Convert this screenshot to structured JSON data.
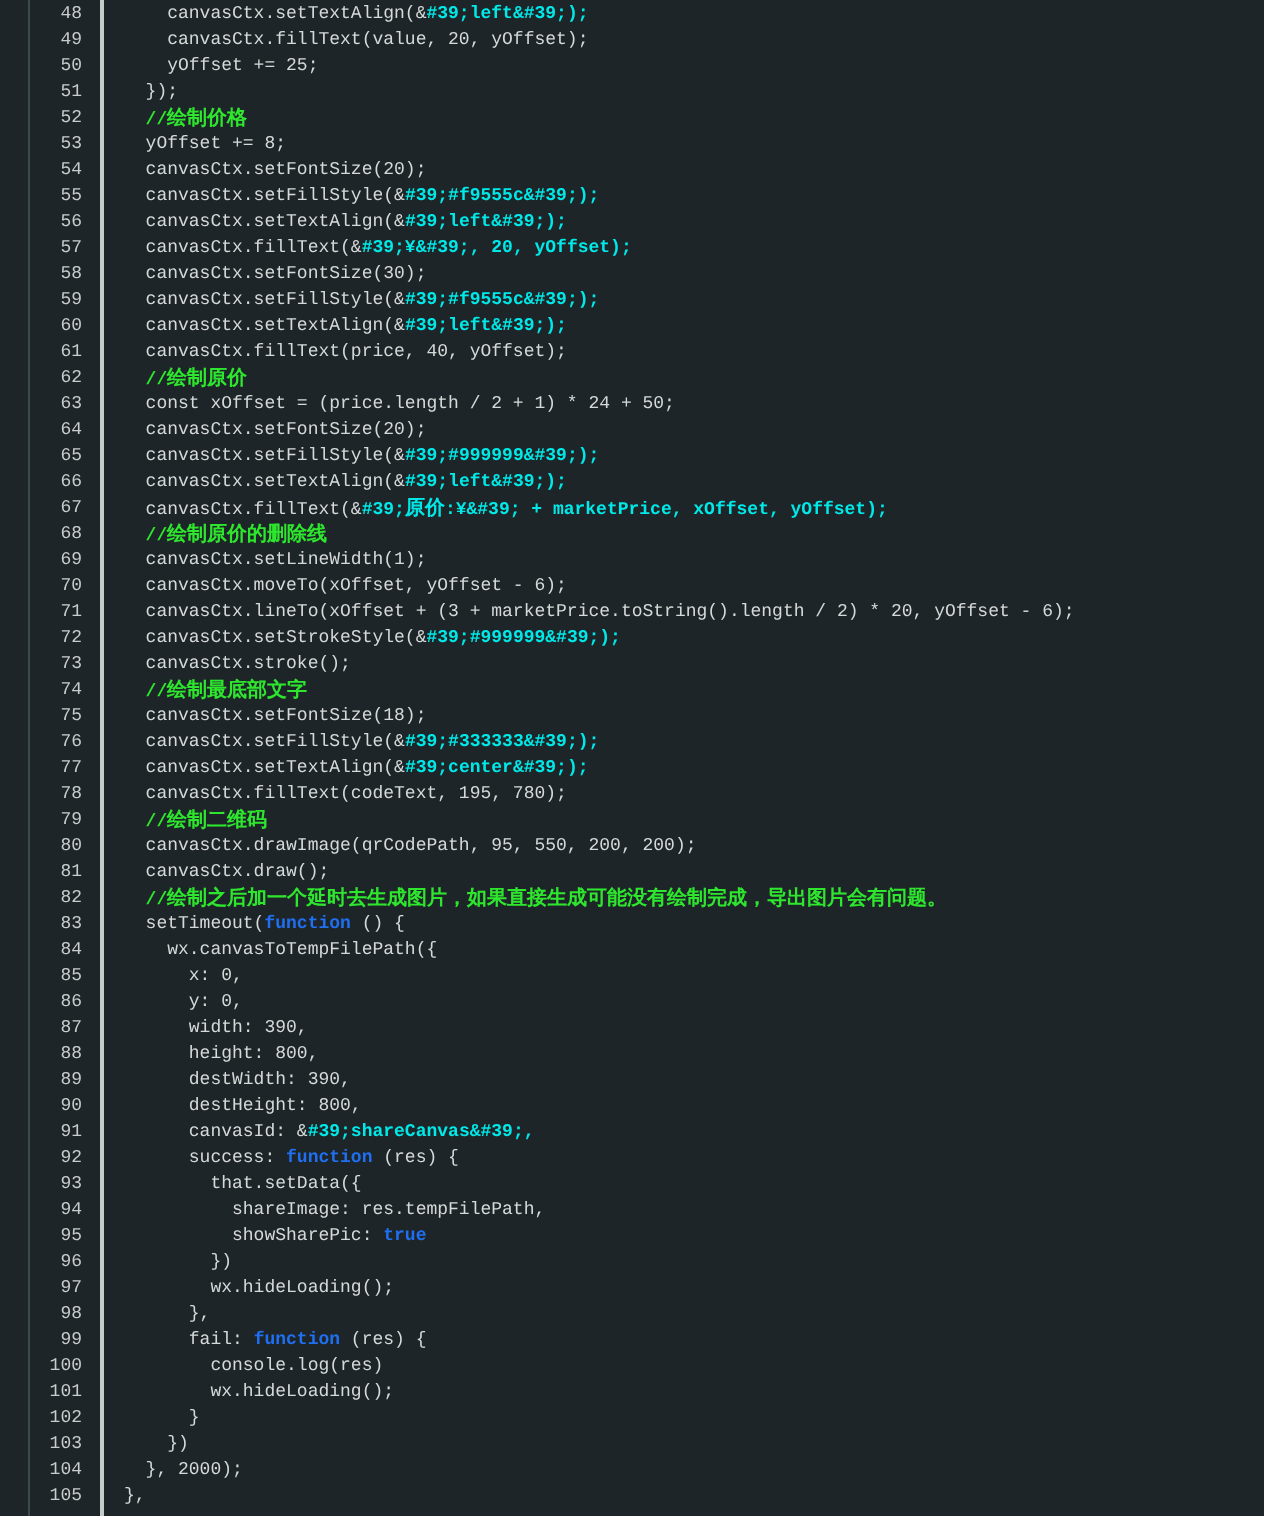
{
  "editor": {
    "lines": [
      {
        "number": "48",
        "segments": [
          {
            "kind": "plain",
            "text": "    canvasCtx.setTextAlign(&"
          },
          {
            "kind": "string",
            "text": "#39;left&#39;);"
          }
        ]
      },
      {
        "number": "49",
        "segments": [
          {
            "kind": "plain",
            "text": "    canvasCtx.fillText(value, 20, yOffset);"
          }
        ]
      },
      {
        "number": "50",
        "segments": [
          {
            "kind": "plain",
            "text": "    yOffset += 25;"
          }
        ]
      },
      {
        "number": "51",
        "segments": [
          {
            "kind": "plain",
            "text": "  });"
          }
        ]
      },
      {
        "number": "52",
        "segments": [
          {
            "kind": "comment",
            "text": "  //绘制价格"
          }
        ]
      },
      {
        "number": "53",
        "segments": [
          {
            "kind": "plain",
            "text": "  yOffset += 8;"
          }
        ]
      },
      {
        "number": "54",
        "segments": [
          {
            "kind": "plain",
            "text": "  canvasCtx.setFontSize(20);"
          }
        ]
      },
      {
        "number": "55",
        "segments": [
          {
            "kind": "plain",
            "text": "  canvasCtx.setFillStyle(&"
          },
          {
            "kind": "string",
            "text": "#39;#f9555c&#39;);"
          }
        ]
      },
      {
        "number": "56",
        "segments": [
          {
            "kind": "plain",
            "text": "  canvasCtx.setTextAlign(&"
          },
          {
            "kind": "string",
            "text": "#39;left&#39;);"
          }
        ]
      },
      {
        "number": "57",
        "segments": [
          {
            "kind": "plain",
            "text": "  canvasCtx.fillText(&"
          },
          {
            "kind": "string",
            "text": "#39;¥&#39;, 20, yOffset);"
          }
        ]
      },
      {
        "number": "58",
        "segments": [
          {
            "kind": "plain",
            "text": "  canvasCtx.setFontSize(30);"
          }
        ]
      },
      {
        "number": "59",
        "segments": [
          {
            "kind": "plain",
            "text": "  canvasCtx.setFillStyle(&"
          },
          {
            "kind": "string",
            "text": "#39;#f9555c&#39;);"
          }
        ]
      },
      {
        "number": "60",
        "segments": [
          {
            "kind": "plain",
            "text": "  canvasCtx.setTextAlign(&"
          },
          {
            "kind": "string",
            "text": "#39;left&#39;);"
          }
        ]
      },
      {
        "number": "61",
        "segments": [
          {
            "kind": "plain",
            "text": "  canvasCtx.fillText(price, 40, yOffset);"
          }
        ]
      },
      {
        "number": "62",
        "segments": [
          {
            "kind": "comment",
            "text": "  //绘制原价"
          }
        ]
      },
      {
        "number": "63",
        "segments": [
          {
            "kind": "plain",
            "text": "  const xOffset = (price.length / 2 + 1) * 24 + 50;"
          }
        ]
      },
      {
        "number": "64",
        "segments": [
          {
            "kind": "plain",
            "text": "  canvasCtx.setFontSize(20);"
          }
        ]
      },
      {
        "number": "65",
        "segments": [
          {
            "kind": "plain",
            "text": "  canvasCtx.setFillStyle(&"
          },
          {
            "kind": "string",
            "text": "#39;#999999&#39;);"
          }
        ]
      },
      {
        "number": "66",
        "segments": [
          {
            "kind": "plain",
            "text": "  canvasCtx.setTextAlign(&"
          },
          {
            "kind": "string",
            "text": "#39;left&#39;);"
          }
        ]
      },
      {
        "number": "67",
        "segments": [
          {
            "kind": "plain",
            "text": "  canvasCtx.fillText(&"
          },
          {
            "kind": "string",
            "text": "#39;原价:¥&#39; + marketPrice, xOffset, yOffset);"
          }
        ]
      },
      {
        "number": "68",
        "segments": [
          {
            "kind": "comment",
            "text": "  //绘制原价的删除线"
          }
        ]
      },
      {
        "number": "69",
        "segments": [
          {
            "kind": "plain",
            "text": "  canvasCtx.setLineWidth(1);"
          }
        ]
      },
      {
        "number": "70",
        "segments": [
          {
            "kind": "plain",
            "text": "  canvasCtx.moveTo(xOffset, yOffset - 6);"
          }
        ]
      },
      {
        "number": "71",
        "segments": [
          {
            "kind": "plain",
            "text": "  canvasCtx.lineTo(xOffset + (3 + marketPrice.toString().length / 2) * 20, yOffset - 6);"
          }
        ]
      },
      {
        "number": "72",
        "segments": [
          {
            "kind": "plain",
            "text": "  canvasCtx.setStrokeStyle(&"
          },
          {
            "kind": "string",
            "text": "#39;#999999&#39;);"
          }
        ]
      },
      {
        "number": "73",
        "segments": [
          {
            "kind": "plain",
            "text": "  canvasCtx.stroke();"
          }
        ]
      },
      {
        "number": "74",
        "segments": [
          {
            "kind": "comment",
            "text": "  //绘制最底部文字"
          }
        ]
      },
      {
        "number": "75",
        "segments": [
          {
            "kind": "plain",
            "text": "  canvasCtx.setFontSize(18);"
          }
        ]
      },
      {
        "number": "76",
        "segments": [
          {
            "kind": "plain",
            "text": "  canvasCtx.setFillStyle(&"
          },
          {
            "kind": "string",
            "text": "#39;#333333&#39;);"
          }
        ]
      },
      {
        "number": "77",
        "segments": [
          {
            "kind": "plain",
            "text": "  canvasCtx.setTextAlign(&"
          },
          {
            "kind": "string",
            "text": "#39;center&#39;);"
          }
        ]
      },
      {
        "number": "78",
        "segments": [
          {
            "kind": "plain",
            "text": "  canvasCtx.fillText(codeText, 195, 780);"
          }
        ]
      },
      {
        "number": "79",
        "segments": [
          {
            "kind": "comment",
            "text": "  //绘制二维码"
          }
        ]
      },
      {
        "number": "80",
        "segments": [
          {
            "kind": "plain",
            "text": "  canvasCtx.drawImage(qrCodePath, 95, 550, 200, 200);"
          }
        ]
      },
      {
        "number": "81",
        "segments": [
          {
            "kind": "plain",
            "text": "  canvasCtx.draw();"
          }
        ]
      },
      {
        "number": "82",
        "segments": [
          {
            "kind": "comment",
            "text": "  //绘制之后加一个延时去生成图片，如果直接生成可能没有绘制完成，导出图片会有问题。"
          }
        ]
      },
      {
        "number": "83",
        "segments": [
          {
            "kind": "plain",
            "text": "  setTimeout("
          },
          {
            "kind": "keyword",
            "text": "function"
          },
          {
            "kind": "plain",
            "text": " () {"
          }
        ]
      },
      {
        "number": "84",
        "segments": [
          {
            "kind": "plain",
            "text": "    wx.canvasToTempFilePath({"
          }
        ]
      },
      {
        "number": "85",
        "segments": [
          {
            "kind": "plain",
            "text": "      x: 0,"
          }
        ]
      },
      {
        "number": "86",
        "segments": [
          {
            "kind": "plain",
            "text": "      y: 0,"
          }
        ]
      },
      {
        "number": "87",
        "segments": [
          {
            "kind": "plain",
            "text": "      width: 390,"
          }
        ]
      },
      {
        "number": "88",
        "segments": [
          {
            "kind": "plain",
            "text": "      height: 800,"
          }
        ]
      },
      {
        "number": "89",
        "segments": [
          {
            "kind": "plain",
            "text": "      destWidth: 390,"
          }
        ]
      },
      {
        "number": "90",
        "segments": [
          {
            "kind": "plain",
            "text": "      destHeight: 800,"
          }
        ]
      },
      {
        "number": "91",
        "segments": [
          {
            "kind": "plain",
            "text": "      canvasId: &"
          },
          {
            "kind": "string",
            "text": "#39;shareCanvas&#39;,"
          }
        ]
      },
      {
        "number": "92",
        "segments": [
          {
            "kind": "plain",
            "text": "      success: "
          },
          {
            "kind": "keyword",
            "text": "function"
          },
          {
            "kind": "plain",
            "text": " (res) {"
          }
        ]
      },
      {
        "number": "93",
        "segments": [
          {
            "kind": "plain",
            "text": "        that.setData({"
          }
        ]
      },
      {
        "number": "94",
        "segments": [
          {
            "kind": "plain",
            "text": "          shareImage: res.tempFilePath,"
          }
        ]
      },
      {
        "number": "95",
        "segments": [
          {
            "kind": "plain",
            "text": "          showSharePic: "
          },
          {
            "kind": "keyword",
            "text": "true"
          }
        ]
      },
      {
        "number": "96",
        "segments": [
          {
            "kind": "plain",
            "text": "        })"
          }
        ]
      },
      {
        "number": "97",
        "segments": [
          {
            "kind": "plain",
            "text": "        wx.hideLoading();"
          }
        ]
      },
      {
        "number": "98",
        "segments": [
          {
            "kind": "plain",
            "text": "      },"
          }
        ]
      },
      {
        "number": "99",
        "segments": [
          {
            "kind": "plain",
            "text": "      fail: "
          },
          {
            "kind": "keyword",
            "text": "function"
          },
          {
            "kind": "plain",
            "text": " (res) {"
          }
        ]
      },
      {
        "number": "100",
        "segments": [
          {
            "kind": "plain",
            "text": "        console.log(res)"
          }
        ]
      },
      {
        "number": "101",
        "segments": [
          {
            "kind": "plain",
            "text": "        wx.hideLoading();"
          }
        ]
      },
      {
        "number": "102",
        "segments": [
          {
            "kind": "plain",
            "text": "      }"
          }
        ]
      },
      {
        "number": "103",
        "segments": [
          {
            "kind": "plain",
            "text": "    })"
          }
        ]
      },
      {
        "number": "104",
        "segments": [
          {
            "kind": "plain",
            "text": "  }, 2000);"
          }
        ]
      },
      {
        "number": "105",
        "segments": [
          {
            "kind": "plain",
            "text": "},"
          }
        ]
      }
    ]
  }
}
